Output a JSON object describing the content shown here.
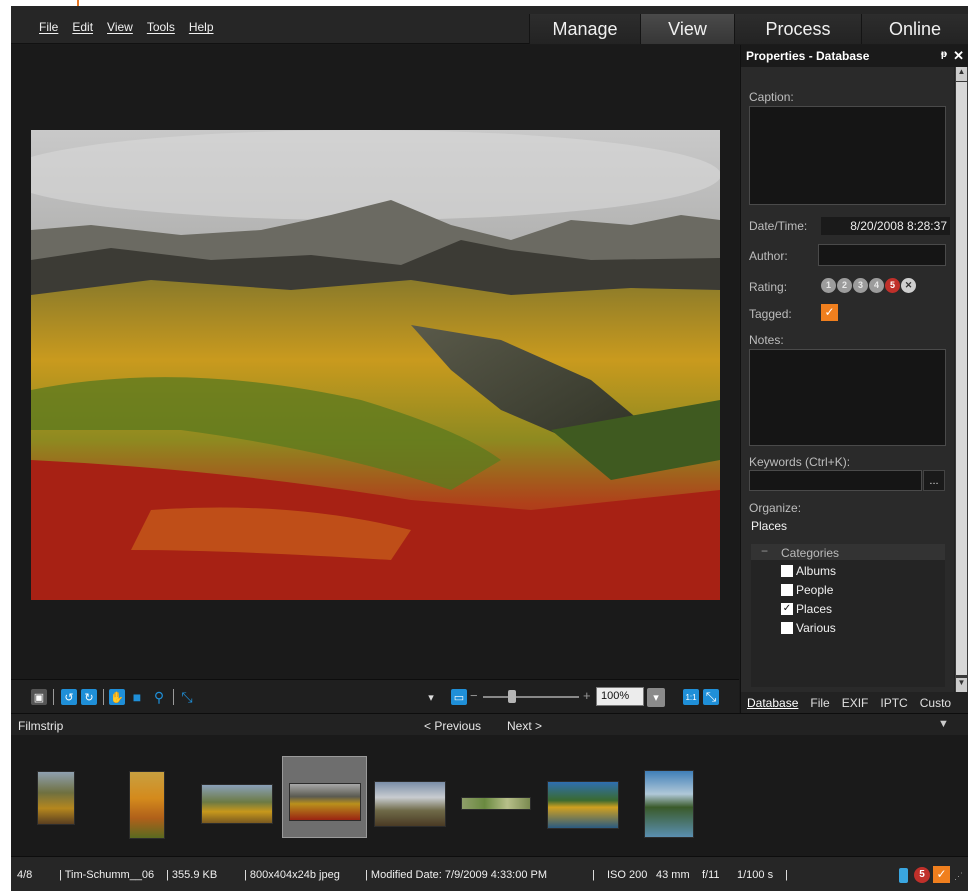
{
  "menu": [
    "File",
    "Edit",
    "View",
    "Tools",
    "Help"
  ],
  "modes": [
    {
      "label": "Manage",
      "active": false
    },
    {
      "label": "View",
      "active": true
    },
    {
      "label": "Process",
      "active": false
    },
    {
      "label": "Online",
      "active": false
    }
  ],
  "properties": {
    "title": "Properties - Database",
    "pin_icon": "pin-icon",
    "close_icon": "close-icon",
    "caption_label": "Caption:",
    "datetime_label": "Date/Time:",
    "datetime_value": "8/20/2008 8:28:37",
    "author_label": "Author:",
    "author_value": "",
    "rating_label": "Rating:",
    "rating_options": [
      "1",
      "2",
      "3",
      "4",
      "5",
      "✕"
    ],
    "rating_selected": "5",
    "tagged_label": "Tagged:",
    "tagged": true,
    "notes_label": "Notes:",
    "keywords_label": "Keywords (Ctrl+K):",
    "keywords_value": "",
    "keywords_button": "...",
    "organize_label": "Organize:",
    "organize_value": "Places",
    "categories_title": "Categories",
    "categories": [
      {
        "label": "Albums",
        "checked": false
      },
      {
        "label": "People",
        "checked": false
      },
      {
        "label": "Places",
        "checked": true
      },
      {
        "label": "Various",
        "checked": false
      }
    ],
    "tabs": [
      "Database",
      "File",
      "EXIF",
      "IPTC",
      "Custo"
    ],
    "active_tab": "Database"
  },
  "viewer_toolbar": {
    "zoom_value": "100%",
    "zoom_minus": "−",
    "zoom_plus": "+",
    "one_to_one": "1:1"
  },
  "filmstrip": {
    "title": "Filmstrip",
    "previous_label": "< Previous",
    "next_label": "Next >"
  },
  "status": {
    "index": "4/8",
    "filename": "Tim-Schumm__06",
    "filesize": "355.9 KB",
    "dimensions": "800x404x24b jpeg",
    "modified": "Modified Date: 7/9/2009 4:33:00 PM",
    "iso": "ISO 200",
    "focal": "43 mm",
    "aperture": "f/11",
    "shutter": "1/100 s",
    "rating_badge": "5"
  },
  "colors": {
    "accent_orange": "#f07f1e",
    "accent_blue": "#1f8fd8",
    "rating_red": "#c0302a",
    "background": "#1b1b1b"
  }
}
